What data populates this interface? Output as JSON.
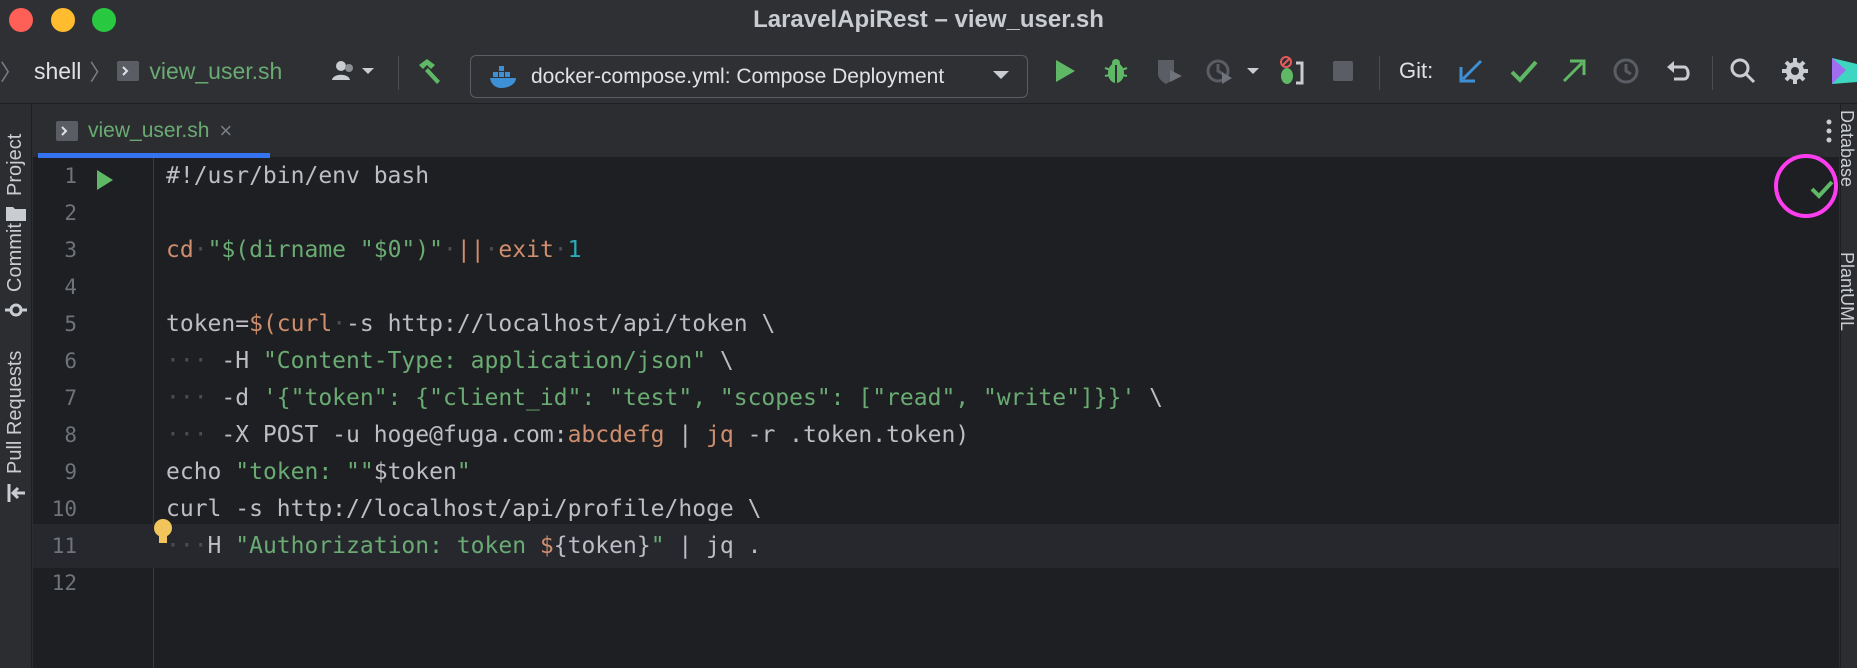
{
  "window": {
    "title": "LaravelApiRest – view_user.sh"
  },
  "toolbar": {
    "breadcrumb": [
      "shell",
      "view_user.sh"
    ],
    "run_config_label": "docker-compose.yml: Compose Deployment",
    "git_label": "Git:"
  },
  "left_tools": [
    "Project",
    "Commit",
    "Pull Requests"
  ],
  "right_tools": [
    "Database",
    "PlantUML"
  ],
  "editor": {
    "tab_label": "view_user.sh",
    "line_numbers": [
      "1",
      "2",
      "3",
      "4",
      "5",
      "6",
      "7",
      "8",
      "9",
      "10",
      "11",
      "12"
    ],
    "lines": [
      {
        "n": "1",
        "segments": [
          [
            "plain",
            "#!/usr/bin/env bash"
          ]
        ]
      },
      {
        "n": "2",
        "segments": []
      },
      {
        "n": "3",
        "segments": [
          [
            "kw",
            "cd"
          ],
          [
            "ws",
            " "
          ],
          [
            "str",
            "\"$(dirname "
          ],
          [
            "str",
            "\"$0\""
          ],
          [
            "str",
            ")\""
          ],
          [
            "ws",
            " "
          ],
          [
            "kw",
            "||"
          ],
          [
            "ws",
            " "
          ],
          [
            "kw",
            "exit"
          ],
          [
            "ws",
            " "
          ],
          [
            "num",
            "1"
          ]
        ]
      },
      {
        "n": "4",
        "segments": []
      },
      {
        "n": "5",
        "segments": [
          [
            "plain",
            "token="
          ],
          [
            "kw",
            "$(curl"
          ],
          [
            "ws",
            " "
          ],
          [
            "plain",
            "-s http://localhost/api/token \\"
          ]
        ]
      },
      {
        "n": "6",
        "segments": [
          [
            "ws",
            "   "
          ],
          [
            "plain",
            " -H "
          ],
          [
            "str",
            "\"Content-Type: application/json\""
          ],
          [
            "plain",
            " \\"
          ]
        ]
      },
      {
        "n": "7",
        "segments": [
          [
            "ws",
            "   "
          ],
          [
            "plain",
            " -d "
          ],
          [
            "str",
            "'{\"token\": {\"client_id\": \"test\", \"scopes\": [\"read\", \"write\"]}}'"
          ],
          [
            "plain",
            " \\"
          ]
        ]
      },
      {
        "n": "8",
        "segments": [
          [
            "ws",
            "   "
          ],
          [
            "plain",
            " -X POST -u hoge@fuga.com:"
          ],
          [
            "kw",
            "abcdefg"
          ],
          [
            "plain",
            " | "
          ],
          [
            "kw",
            "jq"
          ],
          [
            "plain",
            " -r .token.token)"
          ]
        ]
      },
      {
        "n": "9",
        "segments": [
          [
            "plain",
            "echo "
          ],
          [
            "str",
            "\"token: \""
          ],
          [
            "str",
            "\""
          ],
          [
            "plain",
            "$token"
          ],
          [
            "str",
            "\""
          ]
        ]
      },
      {
        "n": "10",
        "segments": [
          [
            "plain",
            "curl -s http://localhost/api/profile/hoge \\"
          ]
        ]
      },
      {
        "n": "11",
        "segments": [
          [
            "ws",
            "   "
          ],
          [
            "plain",
            "H "
          ],
          [
            "str",
            "\"Authorization: token "
          ],
          [
            "kw",
            "$"
          ],
          [
            "plain",
            "{token}"
          ],
          [
            "str",
            "\""
          ],
          [
            "plain",
            " | jq ."
          ]
        ]
      },
      {
        "n": "12",
        "segments": []
      }
    ]
  },
  "colors": {
    "keyword": "#cf8e6d",
    "string": "#6aab73",
    "number": "#2aacb8",
    "accent": "#3574f0",
    "highlight_circle": "#ff3df0"
  }
}
